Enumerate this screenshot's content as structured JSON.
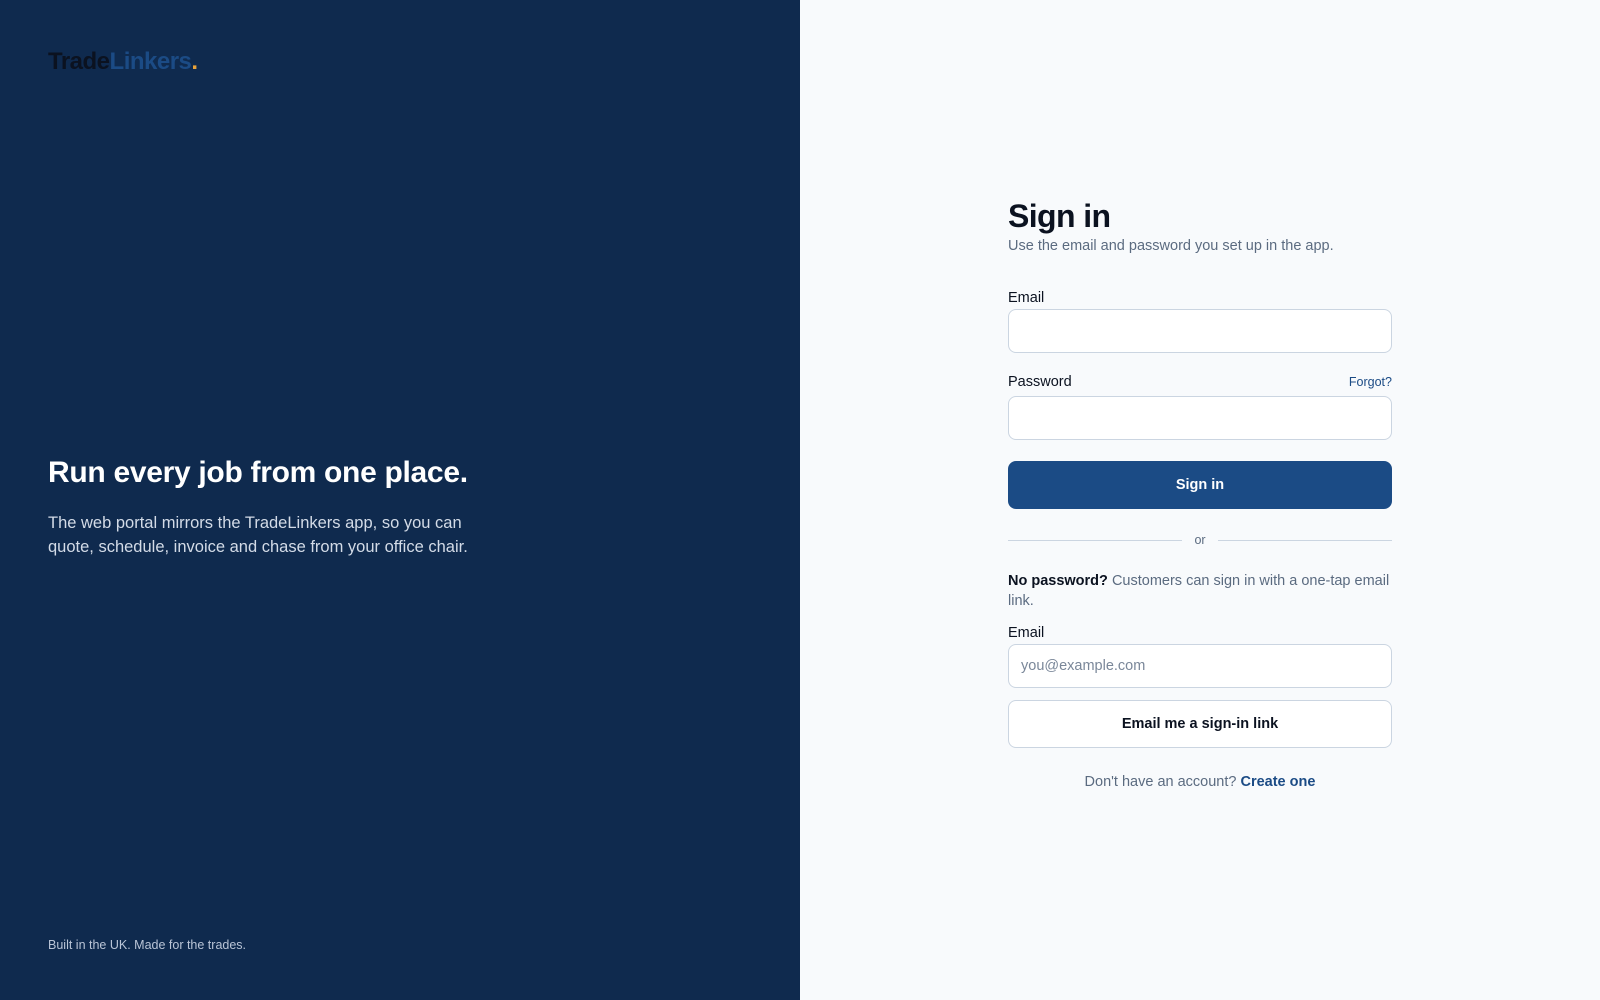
{
  "brand": {
    "part1": "Trade",
    "part2": "Linkers",
    "dot": "."
  },
  "hero": {
    "headline": "Run every job from one place.",
    "description": "The web portal mirrors the TradeLinkers app, so you can quote, schedule, invoice and chase from your office chair."
  },
  "footer_note": "Built in the UK. Made for the trades.",
  "signin": {
    "title": "Sign in",
    "subtitle": "Use the email and password you set up in the app.",
    "email_label": "Email",
    "email_value": "",
    "password_label": "Password",
    "password_value": "",
    "forgot_label": "Forgot?",
    "submit_label": "Sign in",
    "divider_text": "or"
  },
  "magic_link": {
    "lead": "No password?",
    "text": "Customers can sign in with a one-tap email link.",
    "email_label": "Email",
    "email_placeholder": "you@example.com",
    "button_label": "Email me a sign-in link"
  },
  "signup": {
    "prompt": "Don't have an account?",
    "link_label": "Create one"
  },
  "colors": {
    "left_panel_bg": "#0f2a4e",
    "right_panel_bg": "#f8fafc",
    "primary": "#1b4b85",
    "brand_accent_dot": "#e8a33a"
  }
}
